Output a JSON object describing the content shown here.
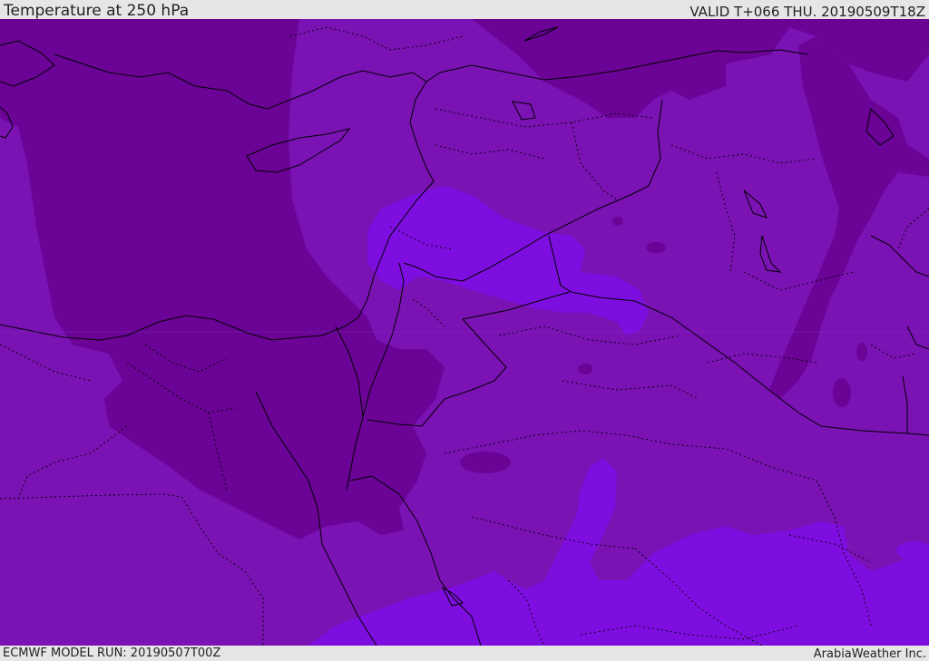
{
  "header": {
    "title": "Temperature at 250 hPa",
    "valid_time": "VALID T+066 THU. 20190509T18Z"
  },
  "footer": {
    "model_run": "ECMWF MODEL RUN: 20190507T00Z",
    "credit": "ArabiaWeather Inc."
  },
  "map": {
    "variable": "Temperature",
    "level": "250 hPa",
    "colors": {
      "cold_dark_purple": "#6a0396",
      "mid_purple": "#7a12b4",
      "warm_violet": "#7e0ee0",
      "warmest_violet": "#8a0be8",
      "boundary_lines": "#000000"
    }
  }
}
